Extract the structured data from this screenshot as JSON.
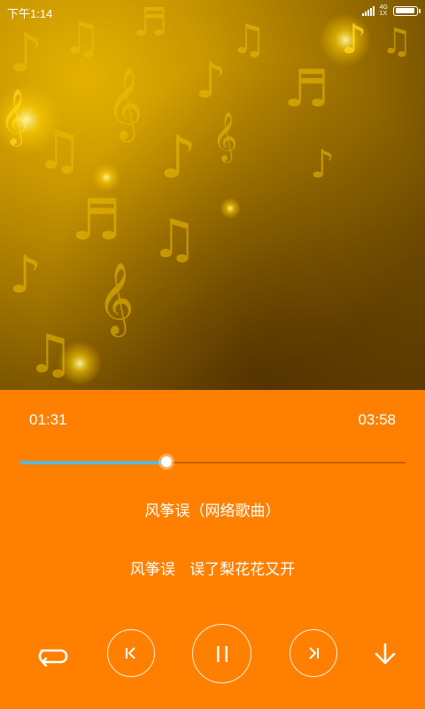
{
  "status_bar": {
    "time": "下午1:14",
    "network_top": "4G",
    "network_bottom": "1X",
    "signal_level": 4,
    "battery_level": 0.95
  },
  "player": {
    "current_time": "01:31",
    "total_time": "03:58",
    "progress": 0.38,
    "song_title": "风筝误（网络歌曲）",
    "lyric": "风筝误   误了梨花花又开"
  },
  "controls": {
    "repeat_icon": "repeat-icon",
    "prev_icon": "previous-track-icon",
    "play_icon": "pause-icon",
    "next_icon": "next-track-icon",
    "down_icon": "arrow-down-icon"
  },
  "colors": {
    "panel_background": "#FF8000",
    "progress_played": "#5cb8d6",
    "artwork_gold": "#c99700"
  }
}
